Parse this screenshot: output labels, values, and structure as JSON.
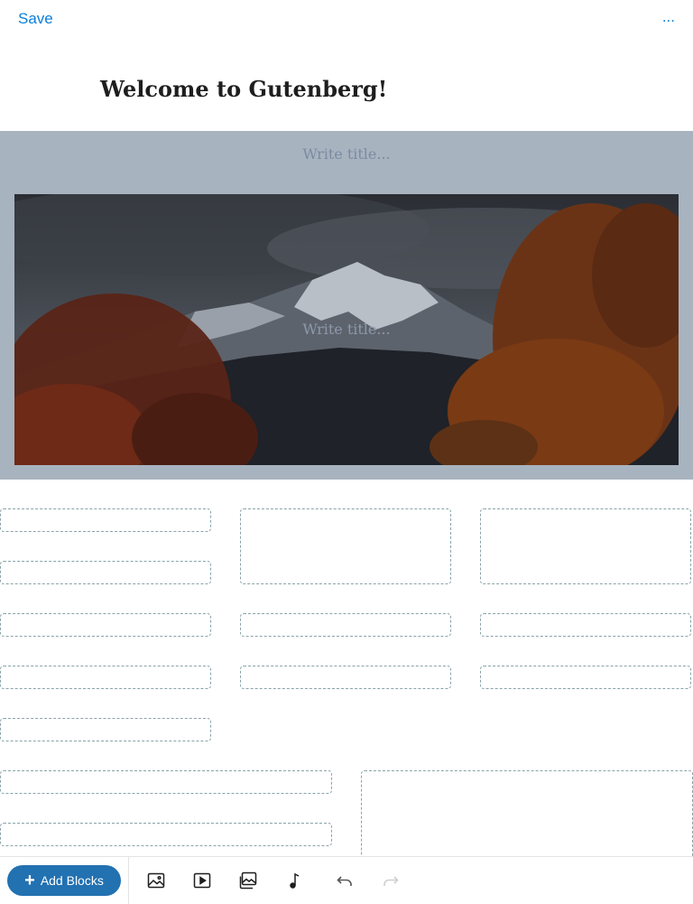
{
  "header": {
    "save_label": "Save",
    "more_label": "..."
  },
  "post": {
    "title": "Welcome to Gutenberg!"
  },
  "cover": {
    "title_placeholder_top": "Write title...",
    "title_placeholder_mid": "Write title..."
  },
  "toolbar": {
    "add_blocks_label": "Add Blocks",
    "icons": [
      "image-icon",
      "video-icon",
      "gallery-icon",
      "audio-icon",
      "undo-icon",
      "redo-icon"
    ]
  },
  "colors": {
    "accent": "#0a7ed9",
    "button": "#2271b1",
    "cover_overlay": "#a8b3c0"
  }
}
